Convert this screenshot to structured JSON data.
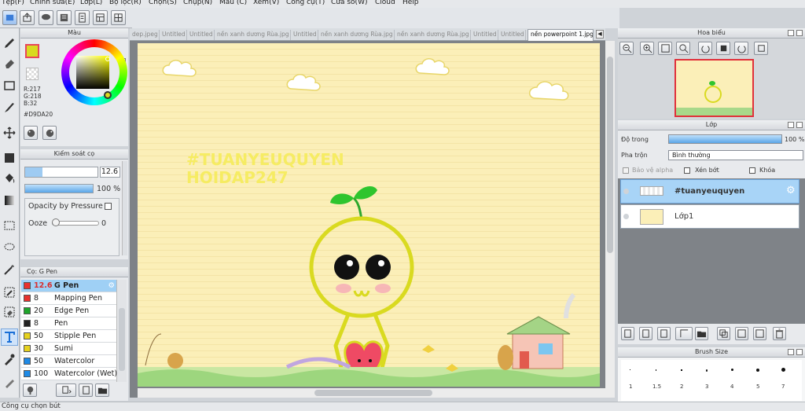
{
  "menu": [
    "Tệp(F)",
    "Chỉnh sửa(E)",
    "Lớp(L)",
    "Bộ lọc(R)",
    "Chọn(S)",
    "Chụp(N)",
    "Màu (C)",
    "Xem(V)",
    "Công cụ(T)",
    "Cửa sổ(W)",
    "Cloud",
    "Help"
  ],
  "color_panel": {
    "title": "Màu",
    "r": "R:217",
    "g": "G:218",
    "b": "B:32",
    "hex": "#D9DA20",
    "main_color": "#D9DA20",
    "sub_color": "#E8465A"
  },
  "control_panel": {
    "title": "Kiểm soát cọ",
    "size_value": "12.6",
    "opacity_value": "100 %",
    "opacity_pressure": "Opacity by Pressure",
    "ooze_label": "Ooze",
    "ooze_value": "0"
  },
  "brush_panel": {
    "title": "Cọ: G Pen",
    "brushes": [
      {
        "size": "12.6",
        "name": "G Pen",
        "color": "#e8322e",
        "selected": true
      },
      {
        "size": "8",
        "name": "Mapping Pen",
        "color": "#e8322e"
      },
      {
        "size": "20",
        "name": "Edge Pen",
        "color": "#1ea52a"
      },
      {
        "size": "8",
        "name": "Pen",
        "color": "#222222"
      },
      {
        "size": "50",
        "name": "Stipple Pen",
        "color": "#e6d21e"
      },
      {
        "size": "30",
        "name": "Sumi",
        "color": "#e6d21e"
      },
      {
        "size": "50",
        "name": "Watercolor",
        "color": "#1e8ae6"
      },
      {
        "size": "100",
        "name": "Watercolor (Wet)",
        "color": "#1e8ae6"
      }
    ]
  },
  "tabs": [
    "dep.jpeg",
    "Untitled",
    "Untitled",
    "nền xanh dương Rùa.jpg",
    "Untitled",
    "nền xanh dương Rùa.jpg",
    "nền xanh dương Rùa.jpg",
    "Untitled",
    "Untitled",
    "nền powerpoint 1.jpg"
  ],
  "canvas": {
    "watermark_line1": "#TUANYEUQUYEN",
    "watermark_line2": "HOIDAP247"
  },
  "navigator": {
    "title": "Hoa biểu"
  },
  "layer_panel": {
    "title": "Lớp",
    "opacity_label": "Độ trong",
    "opacity_value": "100 %",
    "blend_label": "Pha trộn",
    "blend_value": "Bình thường",
    "protect_alpha": "Bảo vệ alpha",
    "clipping": "Xén bớt",
    "lock": "Khóa",
    "layers": [
      {
        "name": "#tuanyeuquyen",
        "selected": true
      },
      {
        "name": "Lớp1",
        "selected": false
      }
    ]
  },
  "brush_size": {
    "title": "Brush Size",
    "sizes": [
      "1",
      "1.5",
      "2",
      "3",
      "4",
      "5",
      "7"
    ]
  },
  "status": {
    "text": "Công cụ chọn bút"
  }
}
